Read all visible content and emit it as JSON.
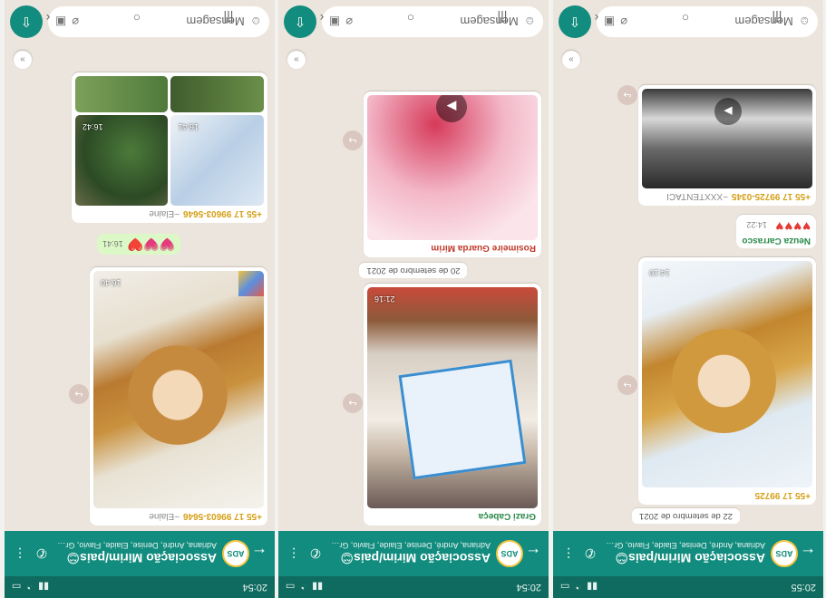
{
  "nav_icons": [
    "back-icon",
    "home-icon",
    "recents-icon"
  ],
  "phones": [
    {
      "status_time": "20:54",
      "group_title": "Associação Mirim/pais😊",
      "members": "Adriana, André, Denise, Elaide, Flavio, Gra...",
      "input_placeholder": "Mensagem",
      "top_sender": "+55 17 99603-5646",
      "top_sender_name": "~Elaine",
      "bottom_sender": "+55 17 99603-5646",
      "bottom_sender_name": "~Elaine",
      "img1_time": "16:40",
      "reaction_time": "16:41",
      "grid_times": [
        "16:41",
        "16:42"
      ]
    },
    {
      "status_time": "20:54",
      "group_title": "Associação Mirim/pais😊",
      "members": "Adriana, André, Denise, Elaide, Flavio, Gra...",
      "input_placeholder": "Mensagem",
      "sender1": "Grazi Cabeça",
      "img1_time": "21:16",
      "date_chip": "20 de setembro de 2021",
      "sender2": "Rosimeire Guarda Mirim"
    },
    {
      "status_time": "20:55",
      "group_title": "Associação Mirim/pais😊",
      "members": "Adriana, André, Denise, Elaide, Flavio, Gra...",
      "input_placeholder": "Mensagem",
      "date_chip": "22 de setembro de 2021",
      "sender1": "+55 17 99725",
      "img1_time": "14:10",
      "sender2": "Neuza Carrasco",
      "hearts": "♥♥♥♥",
      "hearts_time": "14:22",
      "sender3": "+55 17 99725-0345",
      "sender3_name": "~XXXTENTACI"
    }
  ]
}
